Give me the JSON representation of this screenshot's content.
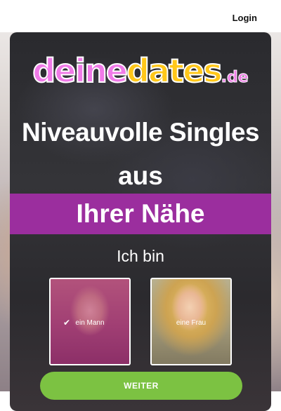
{
  "header": {
    "login_label": "Login"
  },
  "logo": {
    "part1": "deine",
    "part2": "dates",
    "tld": ".de"
  },
  "headline": {
    "line1": "Niveauvolle Singles",
    "line2": "aus",
    "banner": "Ihrer Nähe"
  },
  "selection": {
    "prompt": "Ich bin",
    "options": [
      {
        "label": "ein Mann",
        "selected": true,
        "icon": "check-icon"
      },
      {
        "label": "eine Frau",
        "selected": false
      }
    ]
  },
  "cta": {
    "label": "WEITER"
  },
  "colors": {
    "brand_pink": "#f07ae8",
    "brand_yellow": "#ffc719",
    "banner_purple": "#9b2e9e",
    "cta_green": "#7cc242"
  }
}
